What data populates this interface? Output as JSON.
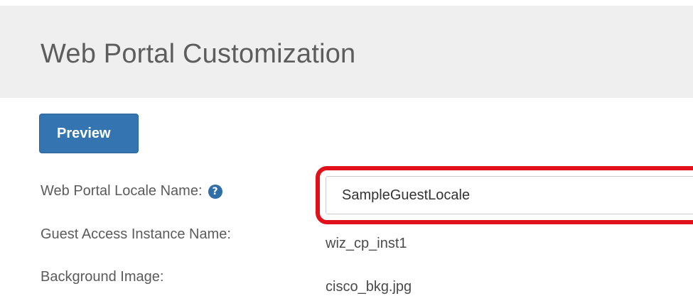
{
  "header": {
    "title": "Web Portal Customization"
  },
  "toolbar": {
    "preview_label": "Preview"
  },
  "form": {
    "locale_name": {
      "label": "Web Portal Locale Name:",
      "help_icon": "?",
      "value": "SampleGuestLocale"
    },
    "guest_access_instance": {
      "label": "Guest Access Instance Name:",
      "value": "wiz_cp_inst1"
    },
    "background_image": {
      "label": "Background Image:",
      "value": "cisco_bkg.jpg"
    }
  },
  "colors": {
    "header_background": "#efefef",
    "button_primary": "#3475b1",
    "highlight": "#e0111a",
    "help_icon": "#2f6ea8"
  },
  "icons": {
    "help": "question-circle-icon"
  }
}
